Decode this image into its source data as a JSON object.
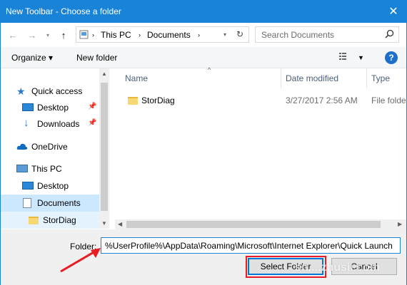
{
  "window": {
    "title": "New Toolbar - Choose a folder",
    "close_glyph": "✕"
  },
  "address": {
    "pc": "This PC",
    "folder": "Documents",
    "search_placeholder": "Search Documents"
  },
  "toolbar": {
    "organize": "Organize ▾",
    "new_folder": "New folder",
    "help": "?"
  },
  "nav": {
    "items": [
      {
        "label": "Quick access",
        "icon": "star-icon"
      },
      {
        "label": "Desktop",
        "icon": "desktop-icon"
      },
      {
        "label": "Downloads",
        "icon": "download-icon"
      },
      {
        "label": "OneDrive",
        "icon": "onedrive-icon"
      },
      {
        "label": "This PC",
        "icon": "computer-icon"
      },
      {
        "label": "Desktop",
        "icon": "desktop-icon"
      },
      {
        "label": "Documents",
        "icon": "document-icon"
      },
      {
        "label": "StorDiag",
        "icon": "folder-icon"
      }
    ]
  },
  "columns": {
    "name": "Name",
    "date": "Date modified",
    "type": "Type"
  },
  "files": [
    {
      "name": "StorDiag",
      "date": "3/27/2017 2:56 AM",
      "type": "File folder"
    }
  ],
  "footer": {
    "folder_label": "Folder:",
    "folder_value": "%UserProfile%\\AppData\\Roaming\\Microsoft\\Internet Explorer\\Quick Launch",
    "select_button": "Select Folder",
    "cancel_button": "Cancel"
  },
  "watermark": "sn....zhusii.com",
  "colors": {
    "titlebar": "#1883d7",
    "selection": "#cce8ff",
    "highlight": "#e81c24"
  }
}
